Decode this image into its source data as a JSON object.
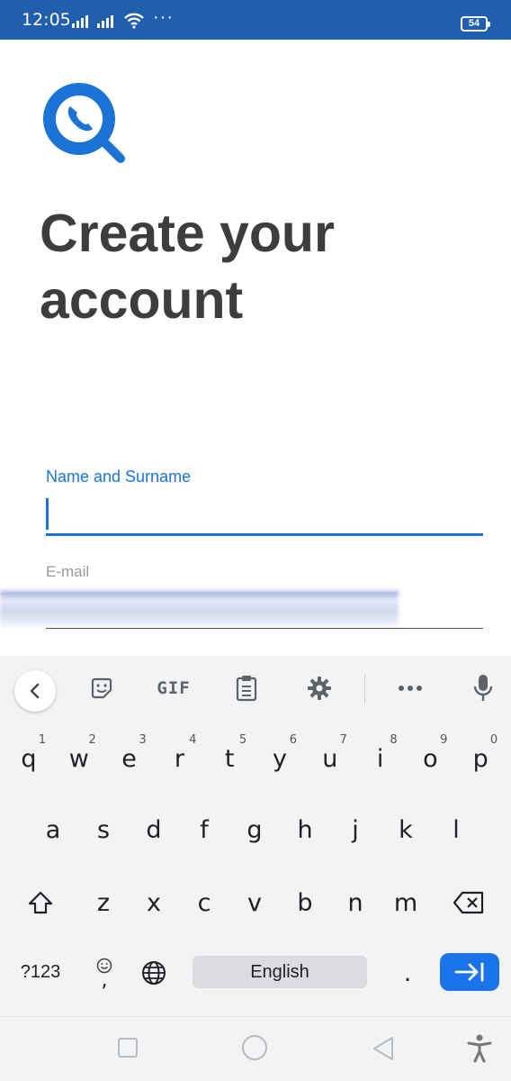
{
  "status_bar": {
    "time": "12:05",
    "dots": "···",
    "battery": "54"
  },
  "app": {
    "brand_color": "#1b73d6",
    "title": "Create your account",
    "fields": {
      "name": {
        "label": "Name and Surname",
        "value": ""
      },
      "email": {
        "label": "E-mail",
        "value": ""
      }
    }
  },
  "keyboard": {
    "toolbar_icons": [
      "chevron-left-icon",
      "sticker-icon",
      "gif-icon",
      "clipboard-icon",
      "gear-icon",
      "more-icon",
      "mic-icon"
    ],
    "gif_label": "GIF",
    "row1": [
      {
        "key": "q",
        "hint": "1"
      },
      {
        "key": "w",
        "hint": "2"
      },
      {
        "key": "e",
        "hint": "3"
      },
      {
        "key": "r",
        "hint": "4"
      },
      {
        "key": "t",
        "hint": "5"
      },
      {
        "key": "y",
        "hint": "6"
      },
      {
        "key": "u",
        "hint": "7"
      },
      {
        "key": "i",
        "hint": "8"
      },
      {
        "key": "o",
        "hint": "9"
      },
      {
        "key": "p",
        "hint": "0"
      }
    ],
    "row2": [
      "a",
      "s",
      "d",
      "f",
      "g",
      "h",
      "j",
      "k",
      "l"
    ],
    "row3": [
      "z",
      "x",
      "c",
      "v",
      "b",
      "n",
      "m"
    ],
    "symbols_label": "?123",
    "space_label": "English",
    "period_label": ".",
    "comma_label": ",",
    "accent_color": "#1a73e8"
  },
  "nav_bar": {
    "icons": [
      "recents-square-icon",
      "home-circle-icon",
      "back-triangle-icon",
      "accessibility-icon"
    ]
  }
}
